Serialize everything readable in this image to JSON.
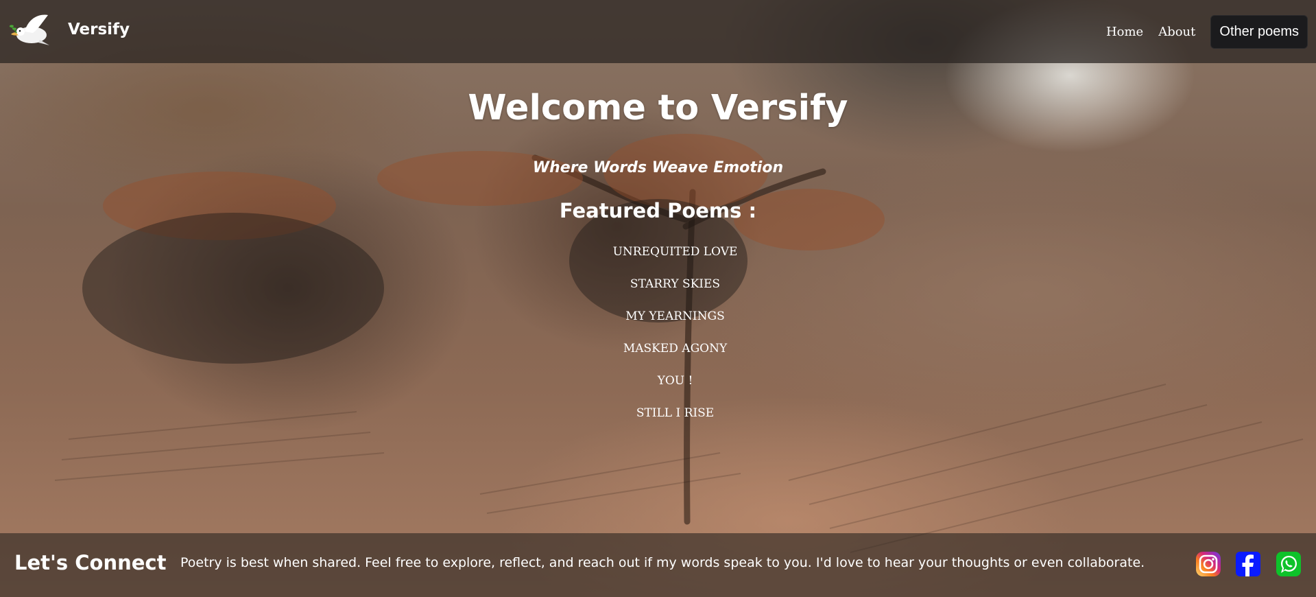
{
  "header": {
    "brand_name": "Versify",
    "nav": {
      "home_label": "Home",
      "about_label": "About",
      "other_poems_label": "Other poems"
    }
  },
  "main": {
    "title": "Welcome to Versify",
    "subtitle": "Where Words Weave Emotion",
    "featured_heading": "Featured Poems :",
    "poems": [
      "UNREQUITED LOVE",
      "STARRY SKIES",
      "MY YEARNINGS",
      "MASKED AGONY",
      "YOU !",
      "STILL I RISE"
    ]
  },
  "footer": {
    "title": "Let's Connect",
    "text": "Poetry is best when shared. Feel free to explore, reflect, and reach out if my words speak to you. I'd love to hear your thoughts or even collaborate.",
    "social": [
      {
        "icon": "instagram-icon"
      },
      {
        "icon": "facebook-icon"
      },
      {
        "icon": "whatsapp-icon"
      }
    ]
  },
  "colors": {
    "nav_button_bg": "#1b1b1d",
    "facebook_blue": "#0a1bff",
    "whatsapp_green": "#25d366"
  }
}
